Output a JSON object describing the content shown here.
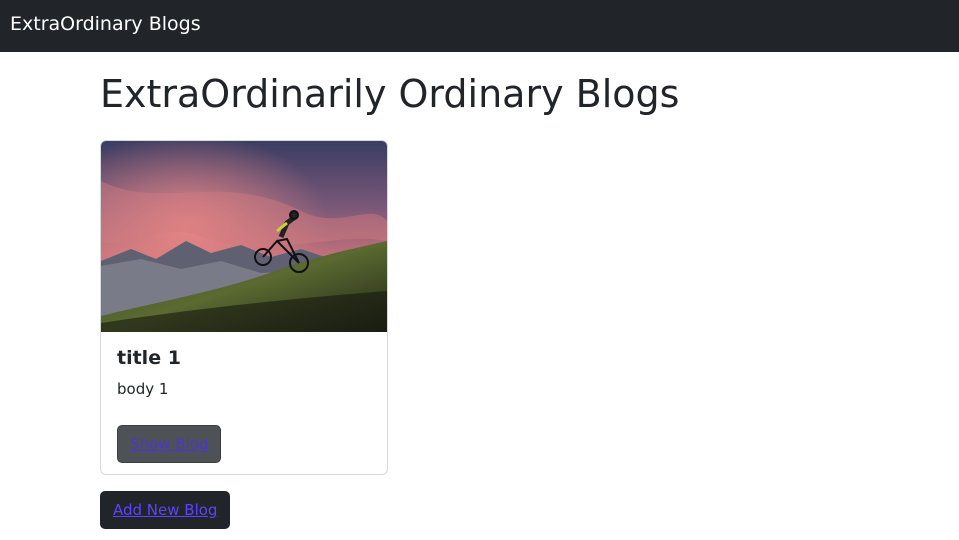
{
  "navbar": {
    "brand": "ExtraOrdinary Blogs"
  },
  "main": {
    "title": "ExtraOrdinarily Ordinary Blogs",
    "add_button_label": "Add New Blog"
  },
  "blogs": [
    {
      "title": "title 1",
      "body": "body 1",
      "image_alt": "mountain-bike-sunset-photo",
      "show_button_label": "Show Blog"
    }
  ]
}
